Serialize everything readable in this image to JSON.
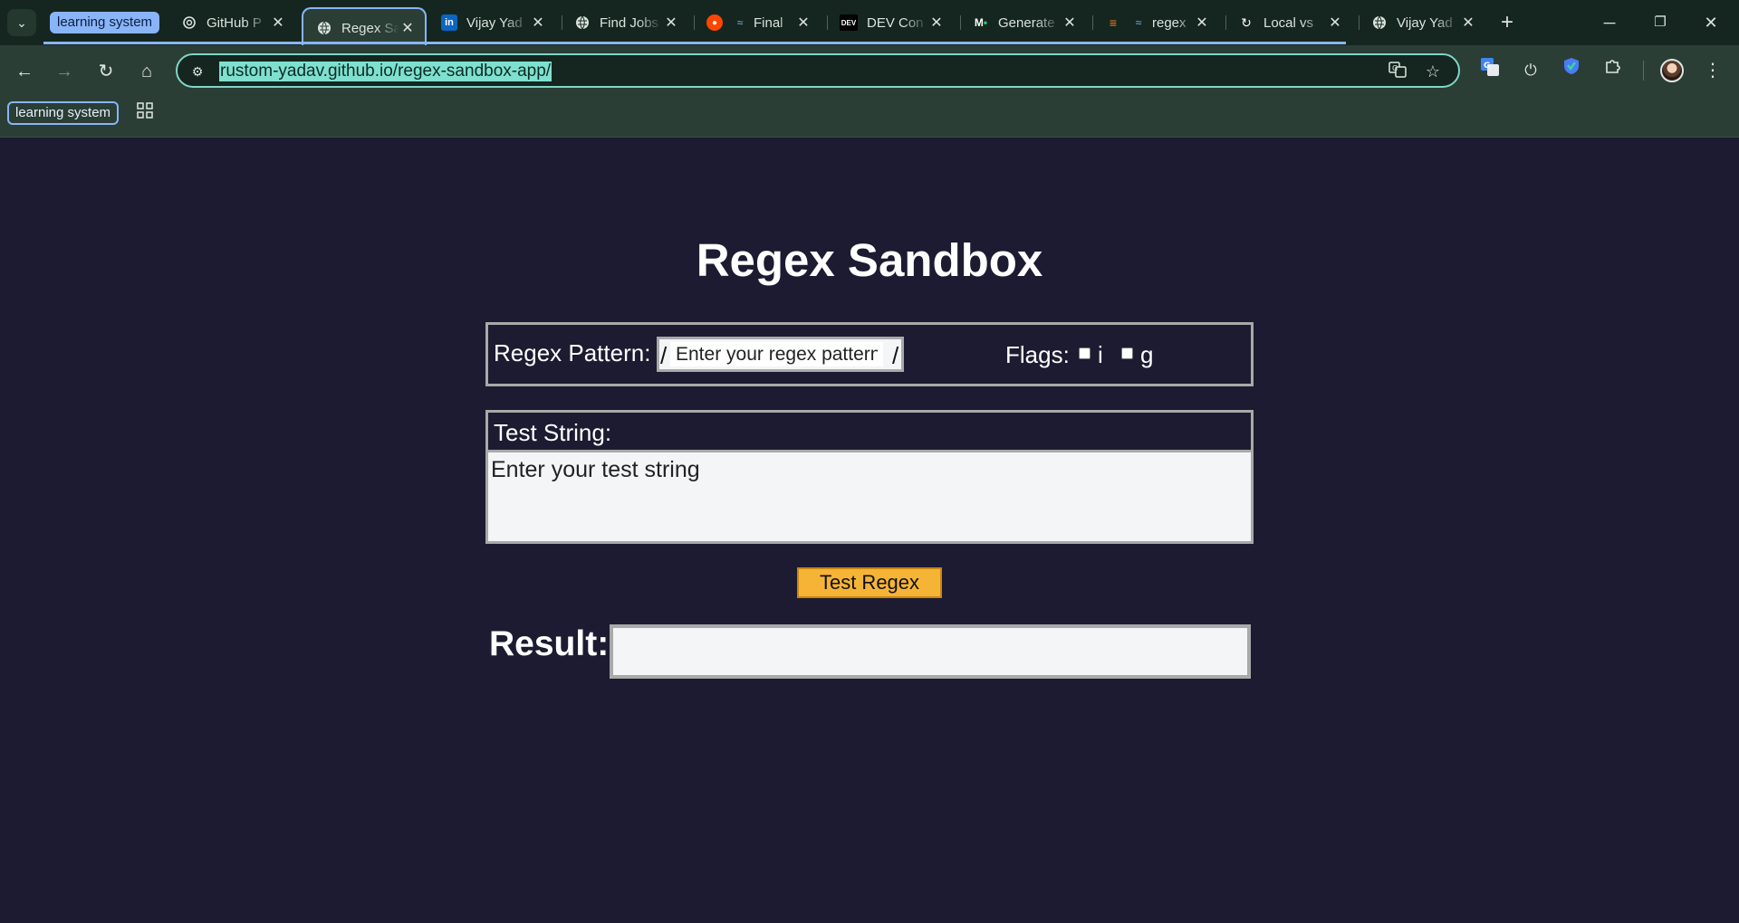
{
  "browser": {
    "tab_group_label": "learning system",
    "tabs": [
      {
        "title": "GitHub P",
        "icon": "openai-icon"
      },
      {
        "title": "Regex Sa",
        "icon": "globe-icon",
        "active": true
      },
      {
        "title": "Vijay Yad",
        "icon": "linkedin-icon"
      },
      {
        "title": "Find Jobs",
        "icon": "globe-icon"
      },
      {
        "title": "Final",
        "icon": "reddit-icon"
      },
      {
        "title": "DEV Con",
        "icon": "dev-icon"
      },
      {
        "title": "Generate",
        "icon": "medium-icon"
      },
      {
        "title": "regex",
        "icon": "stackoverflow-icon"
      },
      {
        "title": "Local vs",
        "icon": "sync-icon"
      },
      {
        "title": "Vijay Yad",
        "icon": "globe-icon"
      }
    ],
    "url": "rustom-yadav.github.io/regex-sandbox-app/",
    "bookmark_group": "learning system"
  },
  "page": {
    "title": "Regex Sandbox",
    "pattern_label": "Regex Pattern:",
    "slash_open": "/",
    "slash_close": "/",
    "pattern_placeholder": "Enter your regex pattern",
    "flags_label": "Flags:",
    "flag_i": "i",
    "flag_g": "g",
    "test_string_label": "Test String:",
    "test_string_placeholder": "Enter your test string",
    "test_button": "Test Regex",
    "result_label": "Result:",
    "result_value": ""
  },
  "colors": {
    "page_background": "#1c1b31",
    "button_background": "#f6b437",
    "chrome_accent": "#8ab4f8",
    "omnibox_border": "#7fd6c7"
  }
}
